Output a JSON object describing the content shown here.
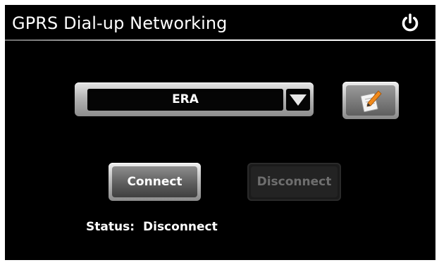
{
  "header": {
    "title": "GPRS Dial-up Networking",
    "power_icon": "power-icon"
  },
  "profile_dropdown": {
    "selected": "ERA",
    "arrow_icon": "chevron-down-icon"
  },
  "edit_button": {
    "icon": "notepad-pencil-icon"
  },
  "actions": {
    "connect_label": "Connect",
    "disconnect_label": "Disconnect",
    "disconnect_enabled": false
  },
  "status": {
    "label": "Status:",
    "value": "Disconnect"
  },
  "colors": {
    "background": "#000000",
    "text": "#ffffff",
    "disabled_text": "#6e6e6e",
    "pencil": "#f08a1c"
  }
}
